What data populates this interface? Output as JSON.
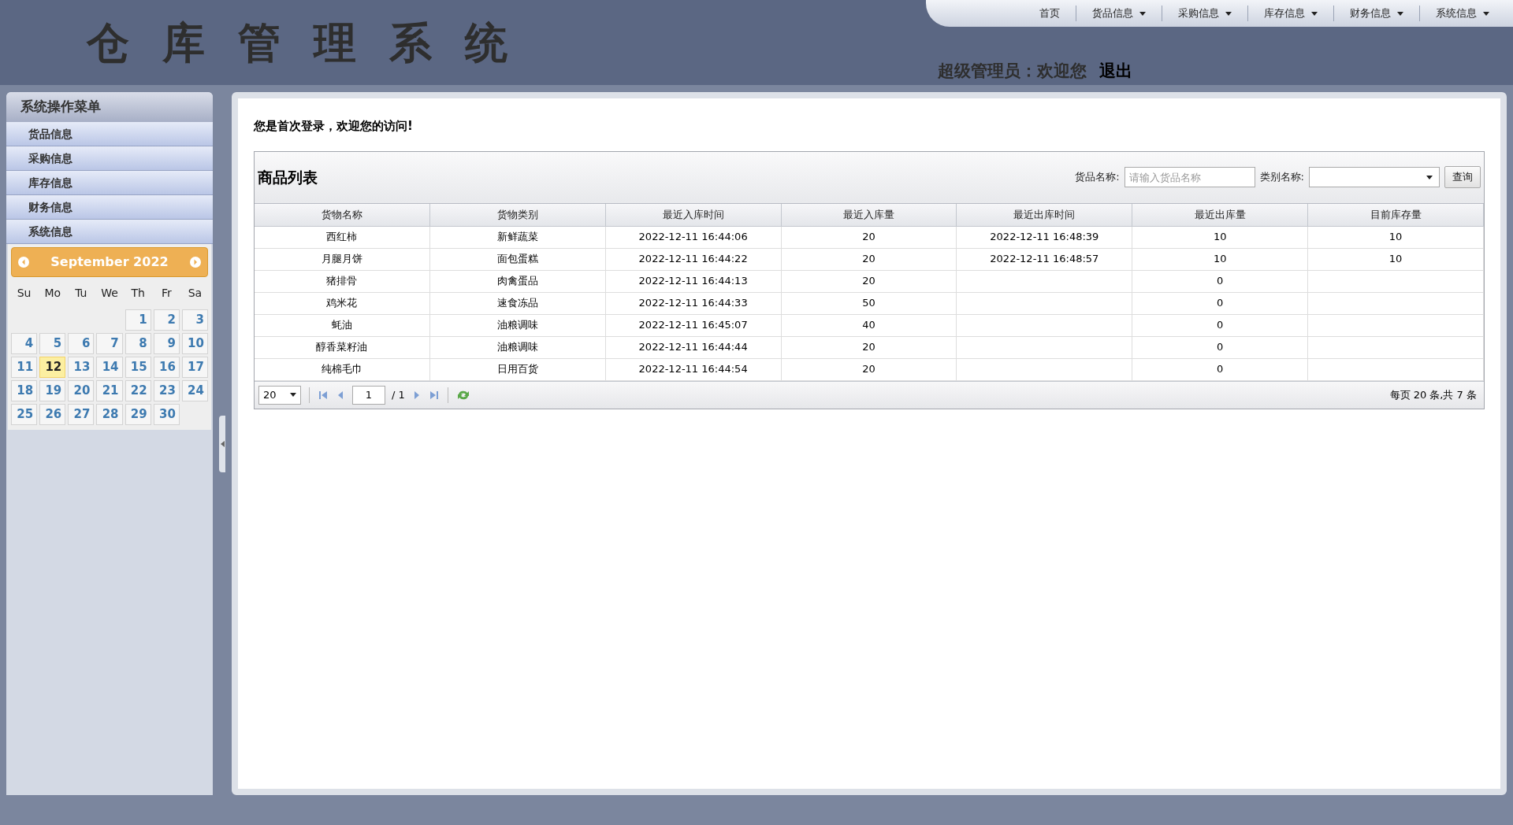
{
  "header": {
    "title": [
      "仓",
      "库",
      "管",
      "理",
      "系",
      "统"
    ],
    "user_greeting": "超级管理员：欢迎您",
    "logout": "退出"
  },
  "top_nav": [
    {
      "label": "首页",
      "dropdown": false
    },
    {
      "label": "货品信息",
      "dropdown": true
    },
    {
      "label": "采购信息",
      "dropdown": true
    },
    {
      "label": "库存信息",
      "dropdown": true
    },
    {
      "label": "财务信息",
      "dropdown": true
    },
    {
      "label": "系统信息",
      "dropdown": true
    }
  ],
  "sidebar": {
    "title": "系统操作菜单",
    "items": [
      "货品信息",
      "采购信息",
      "库存信息",
      "财务信息",
      "系统信息"
    ]
  },
  "calendar": {
    "month": "September 2022",
    "weekdays": [
      "Su",
      "Mo",
      "Tu",
      "We",
      "Th",
      "Fr",
      "Sa"
    ],
    "days": [
      {
        "label": "1",
        "selected": false
      },
      {
        "label": "2",
        "selected": false
      },
      {
        "label": "3",
        "selected": false
      },
      {
        "label": "4",
        "selected": false
      },
      {
        "label": "5",
        "selected": false
      },
      {
        "label": "6",
        "selected": false
      },
      {
        "label": "7",
        "selected": false
      },
      {
        "label": "8",
        "selected": false
      },
      {
        "label": "9",
        "selected": false
      },
      {
        "label": "10",
        "selected": false
      },
      {
        "label": "11",
        "selected": false
      },
      {
        "label": "12",
        "selected": true
      },
      {
        "label": "13",
        "selected": false
      },
      {
        "label": "14",
        "selected": false
      },
      {
        "label": "15",
        "selected": false
      },
      {
        "label": "16",
        "selected": false
      },
      {
        "label": "17",
        "selected": false
      },
      {
        "label": "18",
        "selected": false
      },
      {
        "label": "19",
        "selected": false
      },
      {
        "label": "20",
        "selected": false
      },
      {
        "label": "21",
        "selected": false
      },
      {
        "label": "22",
        "selected": false
      },
      {
        "label": "23",
        "selected": false
      },
      {
        "label": "24",
        "selected": false
      },
      {
        "label": "25",
        "selected": false
      },
      {
        "label": "26",
        "selected": false
      },
      {
        "label": "27",
        "selected": false
      },
      {
        "label": "28",
        "selected": false
      },
      {
        "label": "29",
        "selected": false
      },
      {
        "label": "30",
        "selected": false
      }
    ]
  },
  "welcome": "您是首次登录，欢迎您的访问!",
  "grid": {
    "title": "商品列表",
    "search_label": "货品名称:",
    "search": {
      "placeholder": "请输入货品名称"
    },
    "category_label": "类别名称:",
    "query_button": "查询",
    "columns": [
      "货物名称",
      "货物类别",
      "最近入库时间",
      "最近入库量",
      "最近出库时间",
      "最近出库量",
      "目前库存量"
    ],
    "rows": [
      [
        "西红柿",
        "新鲜蔬菜",
        "2022-12-11 16:44:06",
        "20",
        "2022-12-11 16:48:39",
        "10",
        "10"
      ],
      [
        "月腿月饼",
        "面包蛋糕",
        "2022-12-11 16:44:22",
        "20",
        "2022-12-11 16:48:57",
        "10",
        "10"
      ],
      [
        "猪排骨",
        "肉禽蛋品",
        "2022-12-11 16:44:13",
        "20",
        null,
        "0",
        null
      ],
      [
        "鸡米花",
        "速食冻品",
        "2022-12-11 16:44:33",
        "50",
        null,
        "0",
        null
      ],
      [
        "蚝油",
        "油粮调味",
        "2022-12-11 16:45:07",
        "40",
        null,
        "0",
        null
      ],
      [
        "醇香菜籽油",
        "油粮调味",
        "2022-12-11 16:44:44",
        "20",
        null,
        "0",
        null
      ],
      [
        "纯棉毛巾",
        "日用百货",
        "2022-12-11 16:44:54",
        "20",
        null,
        "0",
        null
      ]
    ],
    "pager": {
      "page_size": "20",
      "page": "1",
      "of_pages": "/ 1",
      "summary": "每页 20 条,共 7 条"
    }
  }
}
